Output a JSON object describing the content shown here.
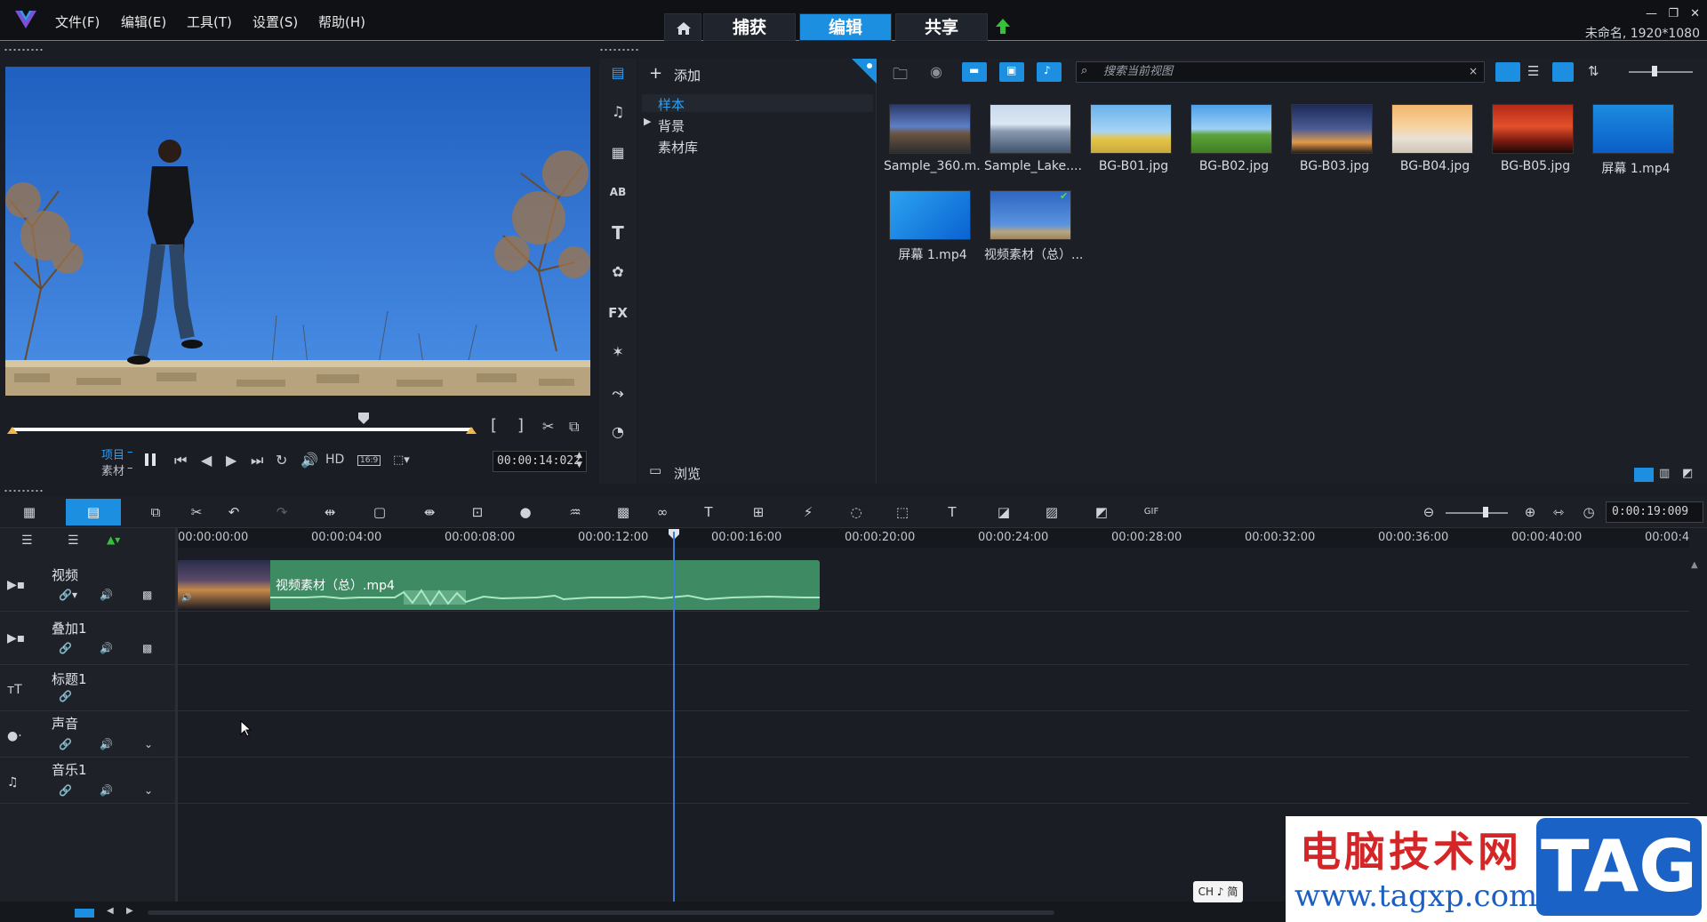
{
  "menu": {
    "items": [
      "文件(F)",
      "编辑(E)",
      "工具(T)",
      "设置(S)",
      "帮助(H)"
    ]
  },
  "modes": {
    "capture": "捕获",
    "edit": "编辑",
    "share": "共享",
    "active": "编辑"
  },
  "window": {
    "project_info": "未命名, 1920*1080"
  },
  "player": {
    "project_label": "项目",
    "clip_label": "素材",
    "hd_label": "HD",
    "aspect_label": "16:9",
    "timecode": "00:00:14:022"
  },
  "library": {
    "add_label": "添加",
    "tree": [
      "样本",
      "背景",
      "素材库"
    ],
    "browse_label": "浏览",
    "search_placeholder": "搜索当前视图",
    "items": [
      {
        "name": "Sample_360.m...",
        "kind": "video"
      },
      {
        "name": "Sample_Lake....",
        "kind": "video"
      },
      {
        "name": "BG-B01.jpg",
        "kind": "image"
      },
      {
        "name": "BG-B02.jpg",
        "kind": "image"
      },
      {
        "name": "BG-B03.jpg",
        "kind": "image"
      },
      {
        "name": "BG-B04.jpg",
        "kind": "image"
      },
      {
        "name": "BG-B05.jpg",
        "kind": "image"
      },
      {
        "name": "屏幕 1.mp4",
        "kind": "video"
      },
      {
        "name": "屏幕 1.mp4",
        "kind": "video"
      },
      {
        "name": "视频素材（总）....",
        "kind": "video"
      }
    ]
  },
  "timeline": {
    "zoom_timecode": "0:00:19:009",
    "ruler": [
      "00:00:00:00",
      "00:00:04:00",
      "00:00:08:00",
      "00:00:12:00",
      "00:00:16:00",
      "00:00:20:00",
      "00:00:24:00",
      "00:00:28:00",
      "00:00:32:00",
      "00:00:36:00",
      "00:00:40:00",
      "00:00:4"
    ],
    "tracks": [
      {
        "name": "视频",
        "icon": "video-track-icon"
      },
      {
        "name": "叠加1",
        "icon": "overlay-track-icon"
      },
      {
        "name": "标题1",
        "icon": "title-track-icon"
      },
      {
        "name": "声音",
        "icon": "voice-track-icon"
      },
      {
        "name": "音乐1",
        "icon": "music-track-icon"
      }
    ],
    "clip_name": "视频素材（总）.mp4"
  },
  "watermark": {
    "cn_text": "电脑技术网",
    "url": "www.tagxp.com",
    "tag": "TAG"
  },
  "ime": {
    "label": "CH ♪ 简"
  },
  "colors": {
    "accent": "#1d8fe0",
    "clip_green": "#3d8a63",
    "playhead": "#3a7bd5"
  }
}
